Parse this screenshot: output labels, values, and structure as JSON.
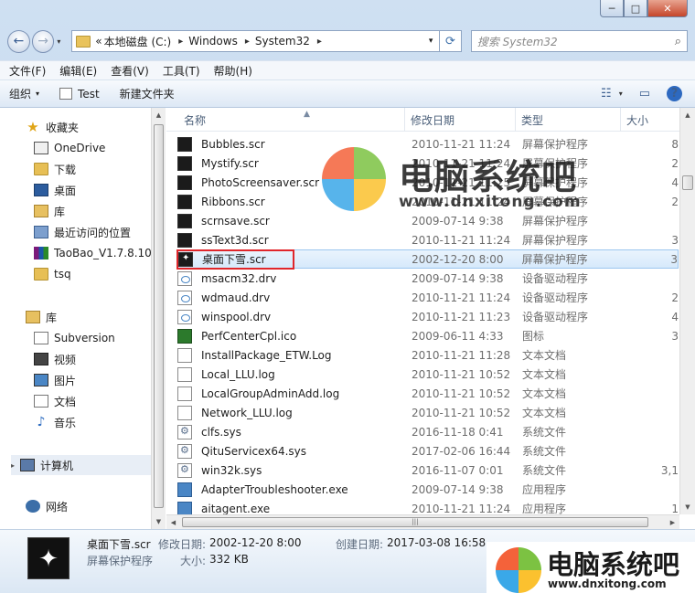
{
  "window": {
    "caption": {
      "minimize": "─",
      "maximize": "□",
      "close": "✕"
    }
  },
  "navbar": {
    "back_icon": "←",
    "forward_icon": "→",
    "dropdown_icon": "▾",
    "address_prefix": "«",
    "breadcrumb": [
      "本地磁盘 (C:)",
      "Windows",
      "System32"
    ],
    "separator": "▸",
    "address_dropdown": "▾",
    "refresh_icon": "⟳",
    "search_placeholder": "搜索 System32",
    "search_icon": "⌕"
  },
  "menubar": {
    "items": [
      "文件(F)",
      "编辑(E)",
      "查看(V)",
      "工具(T)",
      "帮助(H)"
    ]
  },
  "toolbar": {
    "organize": "组织",
    "test": "Test",
    "new_folder": "新建文件夹",
    "view_icon": "☷",
    "view_drop": "▾",
    "preview_icon": "▭",
    "help_icon": "?"
  },
  "sidebar": {
    "favorites": [
      {
        "label": "收藏夹",
        "icon": "star-icon"
      },
      {
        "label": "OneDrive",
        "icon": "onedrive-icon"
      },
      {
        "label": "下载",
        "icon": "downloads-icon"
      },
      {
        "label": "桌面",
        "icon": "desktop-icon"
      },
      {
        "label": "库",
        "icon": "library-icon"
      },
      {
        "label": "最近访问的位置",
        "icon": "recent-places-icon"
      },
      {
        "label": "TaoBao_V1.7.8.10_",
        "icon": "rar-icon"
      },
      {
        "label": "tsq",
        "icon": "folder-icon"
      }
    ],
    "libraries": [
      {
        "label": "库",
        "icon": "library-icon"
      },
      {
        "label": "Subversion",
        "icon": "subversion-icon"
      },
      {
        "label": "视频",
        "icon": "video-icon"
      },
      {
        "label": "图片",
        "icon": "pictures-icon"
      },
      {
        "label": "文档",
        "icon": "documents-icon"
      },
      {
        "label": "音乐",
        "icon": "music-icon"
      }
    ],
    "computer": "计算机",
    "network": "网络",
    "expand_icon": "▸"
  },
  "columns": {
    "name": "名称",
    "date": "修改日期",
    "type": "类型",
    "size": "大小",
    "sort_arrow": "▲"
  },
  "files": [
    {
      "name": "Bubbles.scr",
      "date": "2010-11-21 11:24",
      "type": "屏幕保护程序",
      "size": "8",
      "icon": "screensaver-icon"
    },
    {
      "name": "Mystify.scr",
      "date": "2010-11-21 11:24",
      "type": "屏幕保护程序",
      "size": "2",
      "icon": "screensaver-icon"
    },
    {
      "name": "PhotoScreensaver.scr",
      "date": "2010-11-21 11:25",
      "type": "屏幕保护程序",
      "size": "4",
      "icon": "photo-screensaver-icon"
    },
    {
      "name": "Ribbons.scr",
      "date": "2010-11-21 11:24",
      "type": "屏幕保护程序",
      "size": "2",
      "icon": "screensaver-icon"
    },
    {
      "name": "scrnsave.scr",
      "date": "2009-07-14 9:38",
      "type": "屏幕保护程序",
      "size": "",
      "icon": "screensaver-icon"
    },
    {
      "name": "ssText3d.scr",
      "date": "2010-11-21 11:24",
      "type": "屏幕保护程序",
      "size": "3",
      "icon": "screensaver-icon"
    },
    {
      "name": "桌面下雪.scr",
      "date": "2002-12-20 8:00",
      "type": "屏幕保护程序",
      "size": "3",
      "icon": "snow-screensaver-icon",
      "selected": true
    },
    {
      "name": "msacm32.drv",
      "date": "2009-07-14 9:38",
      "type": "设备驱动程序",
      "size": "",
      "icon": "driver-icon"
    },
    {
      "name": "wdmaud.drv",
      "date": "2010-11-21 11:24",
      "type": "设备驱动程序",
      "size": "2",
      "icon": "driver-icon"
    },
    {
      "name": "winspool.drv",
      "date": "2010-11-21 11:23",
      "type": "设备驱动程序",
      "size": "4",
      "icon": "driver-icon"
    },
    {
      "name": "PerfCenterCpl.ico",
      "date": "2009-06-11 4:33",
      "type": "图标",
      "size": "3",
      "icon": "icon-file-icon"
    },
    {
      "name": "InstallPackage_ETW.Log",
      "date": "2010-11-21 11:28",
      "type": "文本文档",
      "size": "",
      "icon": "text-file-icon"
    },
    {
      "name": "Local_LLU.log",
      "date": "2010-11-21 10:52",
      "type": "文本文档",
      "size": "",
      "icon": "text-file-icon"
    },
    {
      "name": "LocalGroupAdminAdd.log",
      "date": "2010-11-21 10:52",
      "type": "文本文档",
      "size": "",
      "icon": "text-file-icon"
    },
    {
      "name": "Network_LLU.log",
      "date": "2010-11-21 10:52",
      "type": "文本文档",
      "size": "",
      "icon": "text-file-icon"
    },
    {
      "name": "clfs.sys",
      "date": "2016-11-18 0:41",
      "type": "系统文件",
      "size": "",
      "icon": "system-file-icon"
    },
    {
      "name": "QituServicex64.sys",
      "date": "2017-02-06 16:44",
      "type": "系统文件",
      "size": "",
      "icon": "system-file-icon"
    },
    {
      "name": "win32k.sys",
      "date": "2016-11-07 0:01",
      "type": "系统文件",
      "size": "3,1",
      "icon": "system-file-icon"
    },
    {
      "name": "AdapterTroubleshooter.exe",
      "date": "2009-07-14 9:38",
      "type": "应用程序",
      "size": "",
      "icon": "application-icon"
    },
    {
      "name": "aitagent.exe",
      "date": "2010-11-21 11:24",
      "type": "应用程序",
      "size": "1",
      "icon": "application-icon"
    }
  ],
  "details": {
    "filename": "桌面下雪.scr",
    "filetype": "屏幕保护程序",
    "modified_label": "修改日期:",
    "modified_value": "2002-12-20 8:00",
    "created_label": "创建日期:",
    "created_value": "2017-03-08 16:58",
    "size_label": "大小:",
    "size_value": "332 KB"
  },
  "watermark": {
    "title": "电脑系统吧",
    "url_center": "www.dnxitong.com",
    "url_bottom": "www.dnxitong.com",
    "colors": {
      "red": "#f4623a",
      "green": "#7cc242",
      "blue": "#3aa8e8",
      "yellow": "#fbc12f"
    }
  },
  "colors": {
    "selection_border": "#9bc6ef",
    "highlight_box": "#e0262b"
  }
}
